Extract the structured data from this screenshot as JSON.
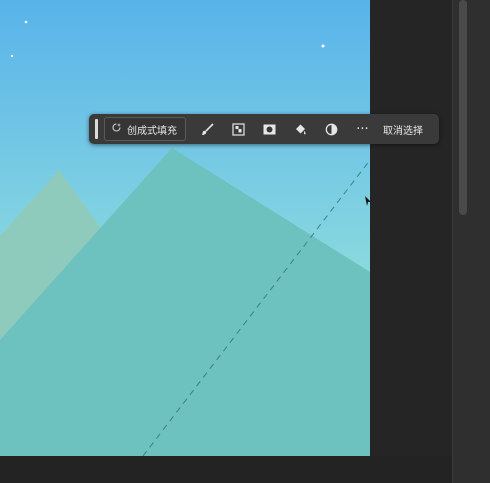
{
  "toolbar": {
    "generative_fill_label": "创成式填充",
    "more_label": "···",
    "deselect_label": "取消选择"
  },
  "icons": {
    "generative_fill": "sparkle-refresh-icon",
    "brush": "brush-icon",
    "select_subject": "select-subject-icon",
    "mask": "mask-icon",
    "fill": "paint-bucket-icon",
    "adjustment": "half-circle-adjustment-icon",
    "more": "more-icon"
  },
  "colors": {
    "sky_top": "#5bb6e8",
    "sky_bottom": "#a6edcc",
    "mountain_front": "#6cc1bf",
    "mountain_back": "#8cc9bc",
    "toolbar_bg": "#3a3a3a",
    "app_bg": "#2b2b2b"
  }
}
